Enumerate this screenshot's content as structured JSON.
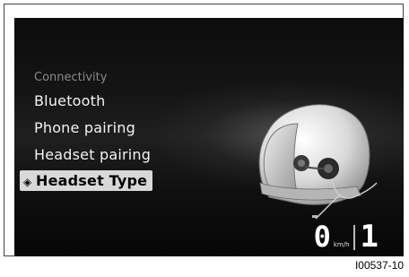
{
  "menu": {
    "header": "Connectivity",
    "items": [
      {
        "label": "Bluetooth"
      },
      {
        "label": "Phone pairing"
      },
      {
        "label": "Headset pairing"
      },
      {
        "label": "Headset Type",
        "selected": true
      }
    ],
    "selected_icon": "diamond-arrow-icon"
  },
  "status": {
    "speed_value": "0",
    "speed_unit": "km/h",
    "gear_value": "1"
  },
  "figure_ref": "I00537-10",
  "colors": {
    "screen_bg": "#111111",
    "text": "#f2f2f2",
    "header_text": "#8a8a8a",
    "selection_bg": "#d8d8d8"
  }
}
